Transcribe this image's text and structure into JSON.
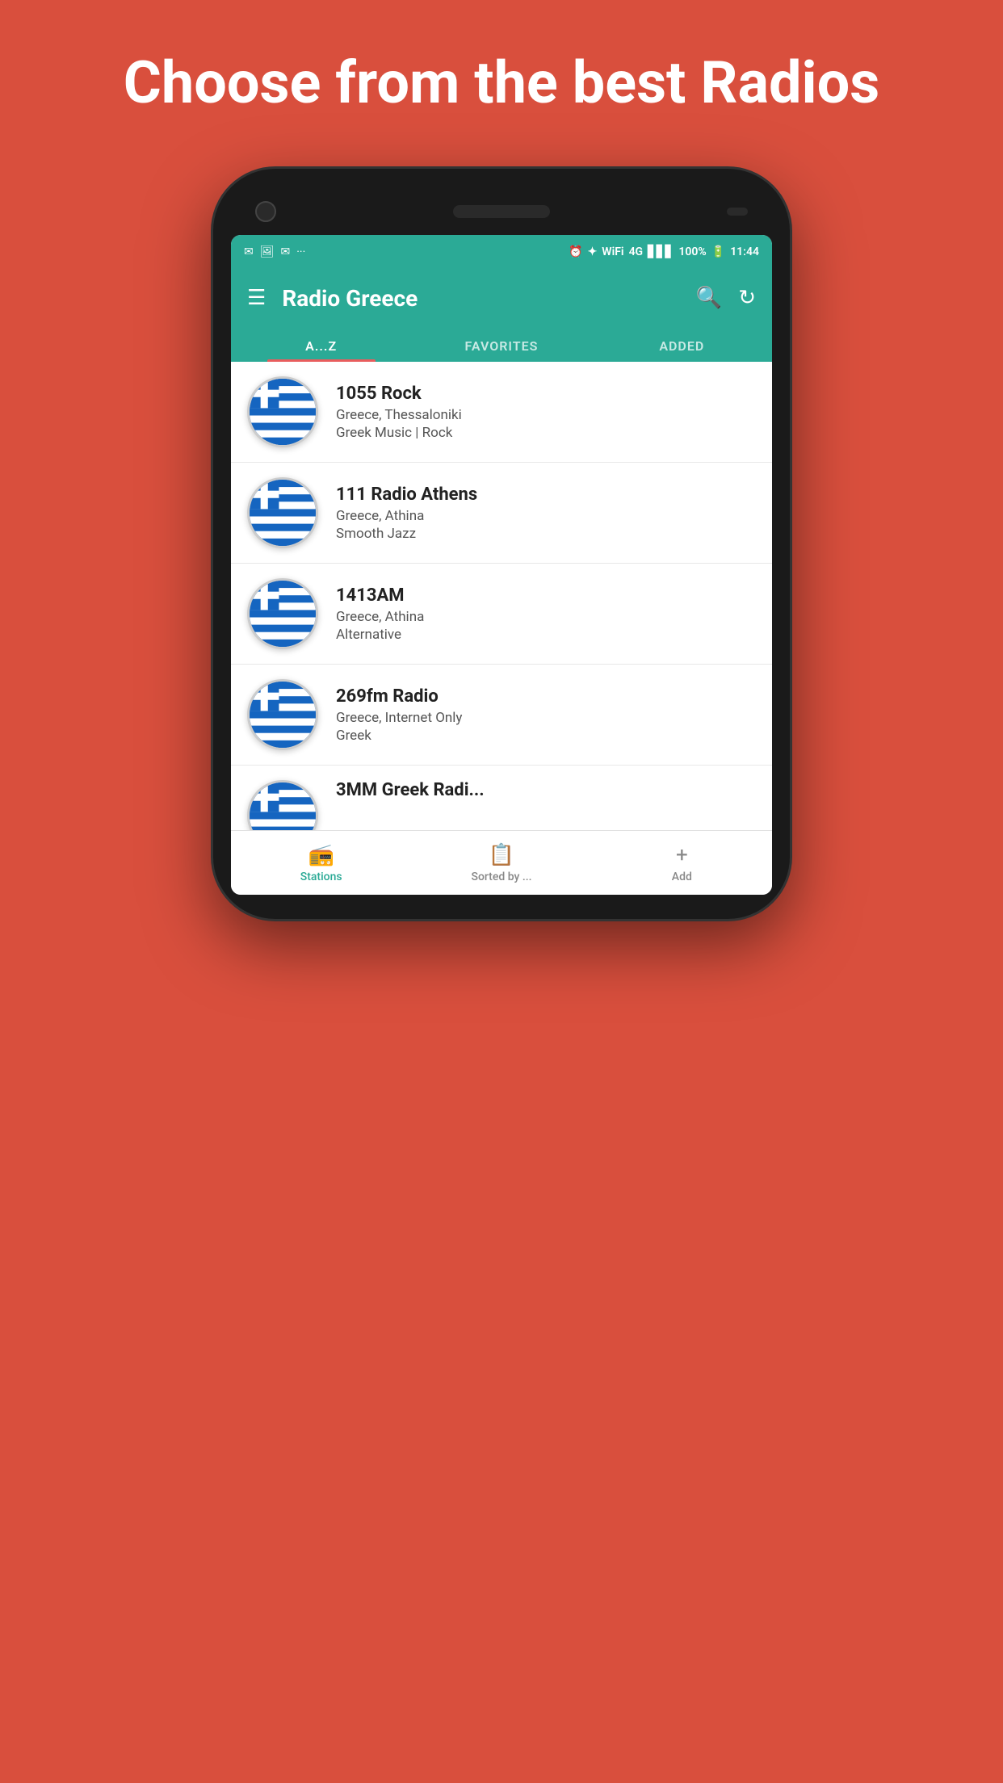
{
  "page": {
    "background_color": "#d94f3d",
    "headline": "Choose from the best Radios"
  },
  "status_bar": {
    "left_icons": [
      "Gmail",
      "Image",
      "Gmail",
      "..."
    ],
    "right_icons": [
      "alarm",
      "bluetooth",
      "wifi",
      "4G",
      "signal",
      "100%",
      "battery",
      "11:44"
    ],
    "time": "11:44",
    "battery": "100%",
    "signal": "4G"
  },
  "app_bar": {
    "title": "Radio Greece",
    "search_label": "search",
    "refresh_label": "refresh",
    "menu_label": "menu"
  },
  "tabs": [
    {
      "id": "az",
      "label": "A...Z",
      "active": true
    },
    {
      "id": "favorites",
      "label": "FAVORITES",
      "active": false
    },
    {
      "id": "added",
      "label": "ADDED",
      "active": false
    }
  ],
  "stations": [
    {
      "id": 1,
      "name": "1055 Rock",
      "location": "Greece, Thessaloniki",
      "genre": "Greek Music | Rock"
    },
    {
      "id": 2,
      "name": "111 Radio Athens",
      "location": "Greece, Athina",
      "genre": "Smooth Jazz"
    },
    {
      "id": 3,
      "name": "1413AM",
      "location": "Greece, Athina",
      "genre": "Alternative"
    },
    {
      "id": 4,
      "name": "269fm Radio",
      "location": "Greece, Internet Only",
      "genre": "Greek"
    },
    {
      "id": 5,
      "name": "3MM Greek Radi...",
      "location": "",
      "genre": ""
    }
  ],
  "bottom_nav": [
    {
      "id": "stations",
      "label": "Stations",
      "icon": "radio",
      "active": true
    },
    {
      "id": "sorted",
      "label": "Sorted by ...",
      "icon": "list",
      "active": false
    },
    {
      "id": "add",
      "label": "Add",
      "icon": "plus",
      "active": false
    }
  ]
}
